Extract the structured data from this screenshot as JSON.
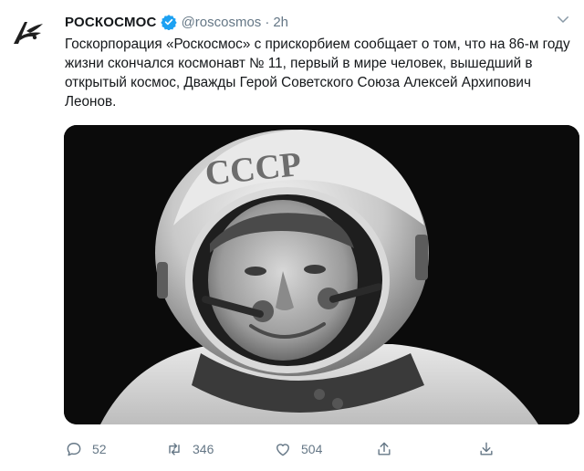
{
  "account": {
    "display_name": "РОСКОСМОС",
    "handle": "@roscosmos",
    "separator": "·",
    "time": "2h",
    "verified": true
  },
  "tweet": {
    "text": "Госкорпорация «Роскосмос» с прискорбием сообщает о том, что на 86-м году жизни скончался космонавт № 11, первый в мире человек, вышедший в открытый космос, Дважды Герой Советского Союза Алексей Архипович Леонов.",
    "helmet_text": "СССР"
  },
  "actions": {
    "replies": "52",
    "retweets": "346",
    "likes": "504"
  },
  "colors": {
    "text": "#14171a",
    "secondary": "#657786",
    "verified": "#1da1f2",
    "media_bg": "#0b0b0b"
  },
  "icons": [
    "roscosmos-logo-icon",
    "verified-badge-icon",
    "chevron-down-icon",
    "reply-icon",
    "retweet-icon",
    "like-icon",
    "share-icon",
    "analytics-icon"
  ]
}
